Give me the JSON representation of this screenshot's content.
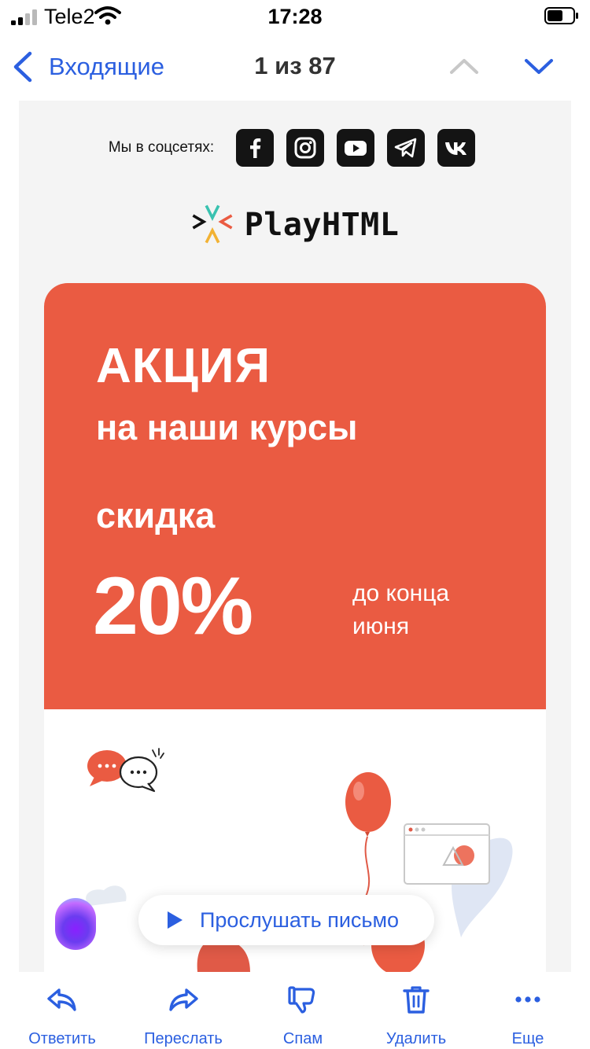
{
  "status_bar": {
    "carrier": "Tele2",
    "time": "17:28"
  },
  "nav": {
    "back_label": "Входящие",
    "counter": "1 из 87"
  },
  "email": {
    "social_label": "Мы в соцсетях:",
    "social_networks": [
      "facebook-icon",
      "instagram-icon",
      "youtube-icon",
      "telegram-icon",
      "vk-icon"
    ],
    "brand": "PlayHTML",
    "promo": {
      "title": "АКЦИЯ",
      "subtitle": "на наши курсы",
      "discount_label": "скидка",
      "discount_value": "20%",
      "deadline": "до конца июня"
    }
  },
  "listen": {
    "label": "Прослушать письмо"
  },
  "toolbar": {
    "reply": "Ответить",
    "forward": "Переслать",
    "spam": "Спам",
    "delete": "Удалить",
    "more": "Еще"
  },
  "colors": {
    "accent": "#2b5fe0",
    "promo_bg": "#ea5b42",
    "mail_bg": "#f4f4f4",
    "icon_dark": "#141414"
  }
}
